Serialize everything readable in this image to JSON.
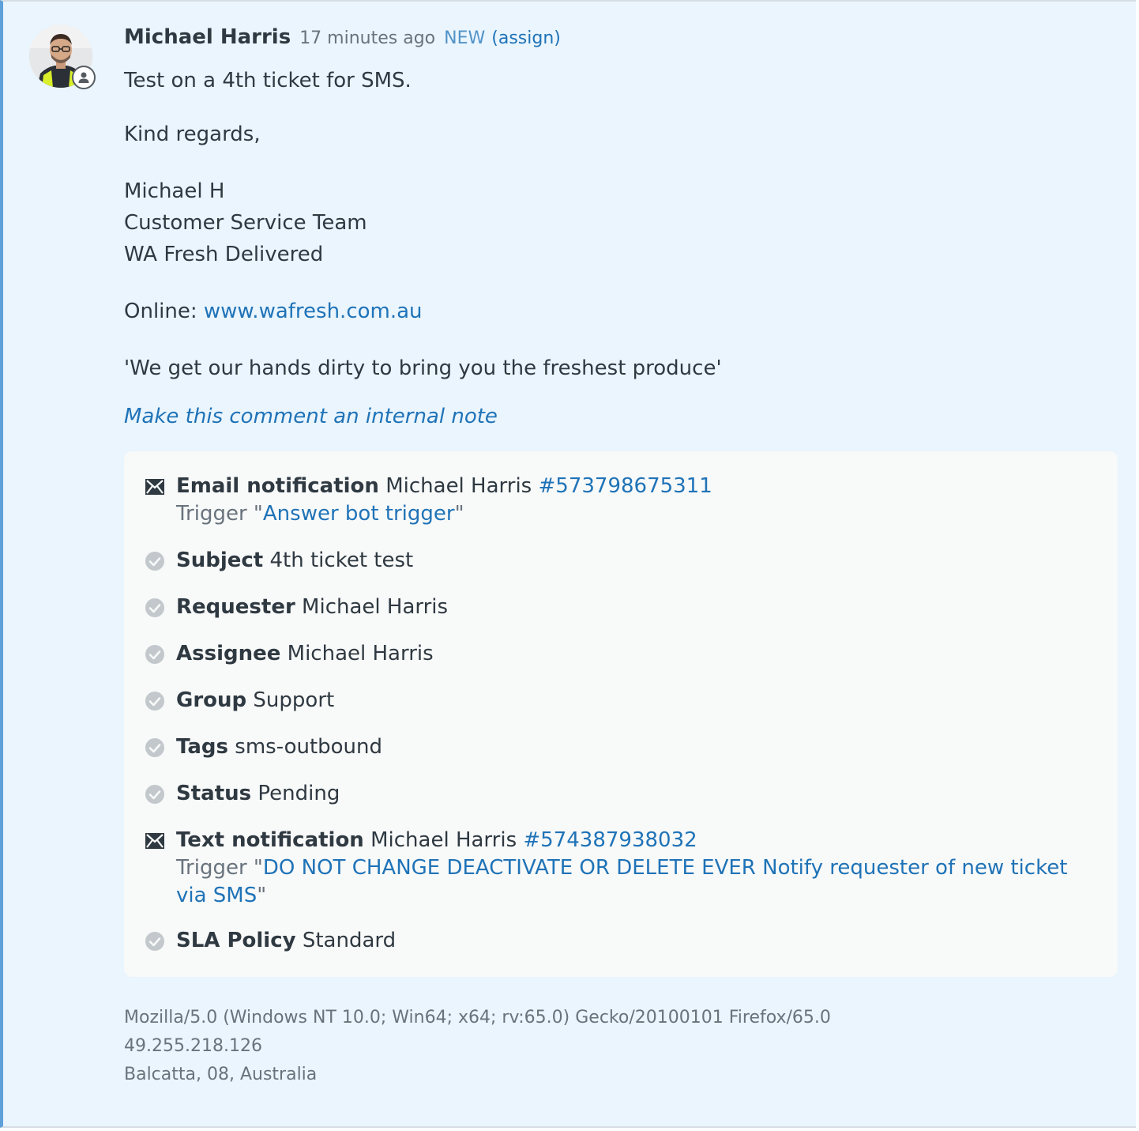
{
  "comment": {
    "author": "Michael Harris",
    "timestamp": "17 minutes ago",
    "status_badge": "NEW",
    "assign_link": "(assign)",
    "body": {
      "line1": "Test on a 4th ticket for SMS.",
      "line2": "Kind regards,",
      "sig_name": "Michael H",
      "sig_team": "Customer Service Team",
      "sig_company": "WA Fresh Delivered",
      "online_label": "Online: ",
      "online_url": "www.wafresh.com.au",
      "tagline": "'We get our hands dirty to bring you the freshest produce'"
    },
    "internal_note_link": "Make this comment an internal note"
  },
  "events": {
    "email": {
      "icon": "envelope-icon",
      "label": "Email notification",
      "recipient": "Michael Harris",
      "id": "#573798675311",
      "trigger_prefix": "Trigger \"",
      "trigger_name": "Answer bot trigger",
      "trigger_suffix": "\""
    },
    "fields": [
      {
        "icon": "check-circle-icon",
        "label": "Subject",
        "value": "4th ticket test"
      },
      {
        "icon": "check-circle-icon",
        "label": "Requester",
        "value": "Michael Harris"
      },
      {
        "icon": "check-circle-icon",
        "label": "Assignee",
        "value": "Michael Harris"
      },
      {
        "icon": "check-circle-icon",
        "label": "Group",
        "value": "Support"
      },
      {
        "icon": "check-circle-icon",
        "label": "Tags",
        "value": "sms-outbound"
      },
      {
        "icon": "check-circle-icon",
        "label": "Status",
        "value": "Pending"
      }
    ],
    "text": {
      "icon": "envelope-icon",
      "label": "Text notification",
      "recipient": "Michael Harris",
      "id": "#574387938032",
      "trigger_prefix": "Trigger \"",
      "trigger_name": "DO NOT CHANGE DEACTIVATE OR DELETE EVER Notify requester of new ticket via SMS",
      "trigger_suffix": "\""
    },
    "sla": {
      "icon": "check-circle-icon",
      "label": "SLA Policy",
      "value": "Standard"
    }
  },
  "metadata": {
    "user_agent": "Mozilla/5.0 (Windows NT 10.0; Win64; x64; rv:65.0) Gecko/20100101 Firefox/65.0",
    "ip": "49.255.218.126",
    "location": "Balcatta, 08, Australia"
  },
  "colors": {
    "background": "#eaf5fe",
    "accent_border": "#5ea0da",
    "link": "#1f73b7",
    "muted": "#68737d",
    "event_panel": "#f8f9f9"
  }
}
